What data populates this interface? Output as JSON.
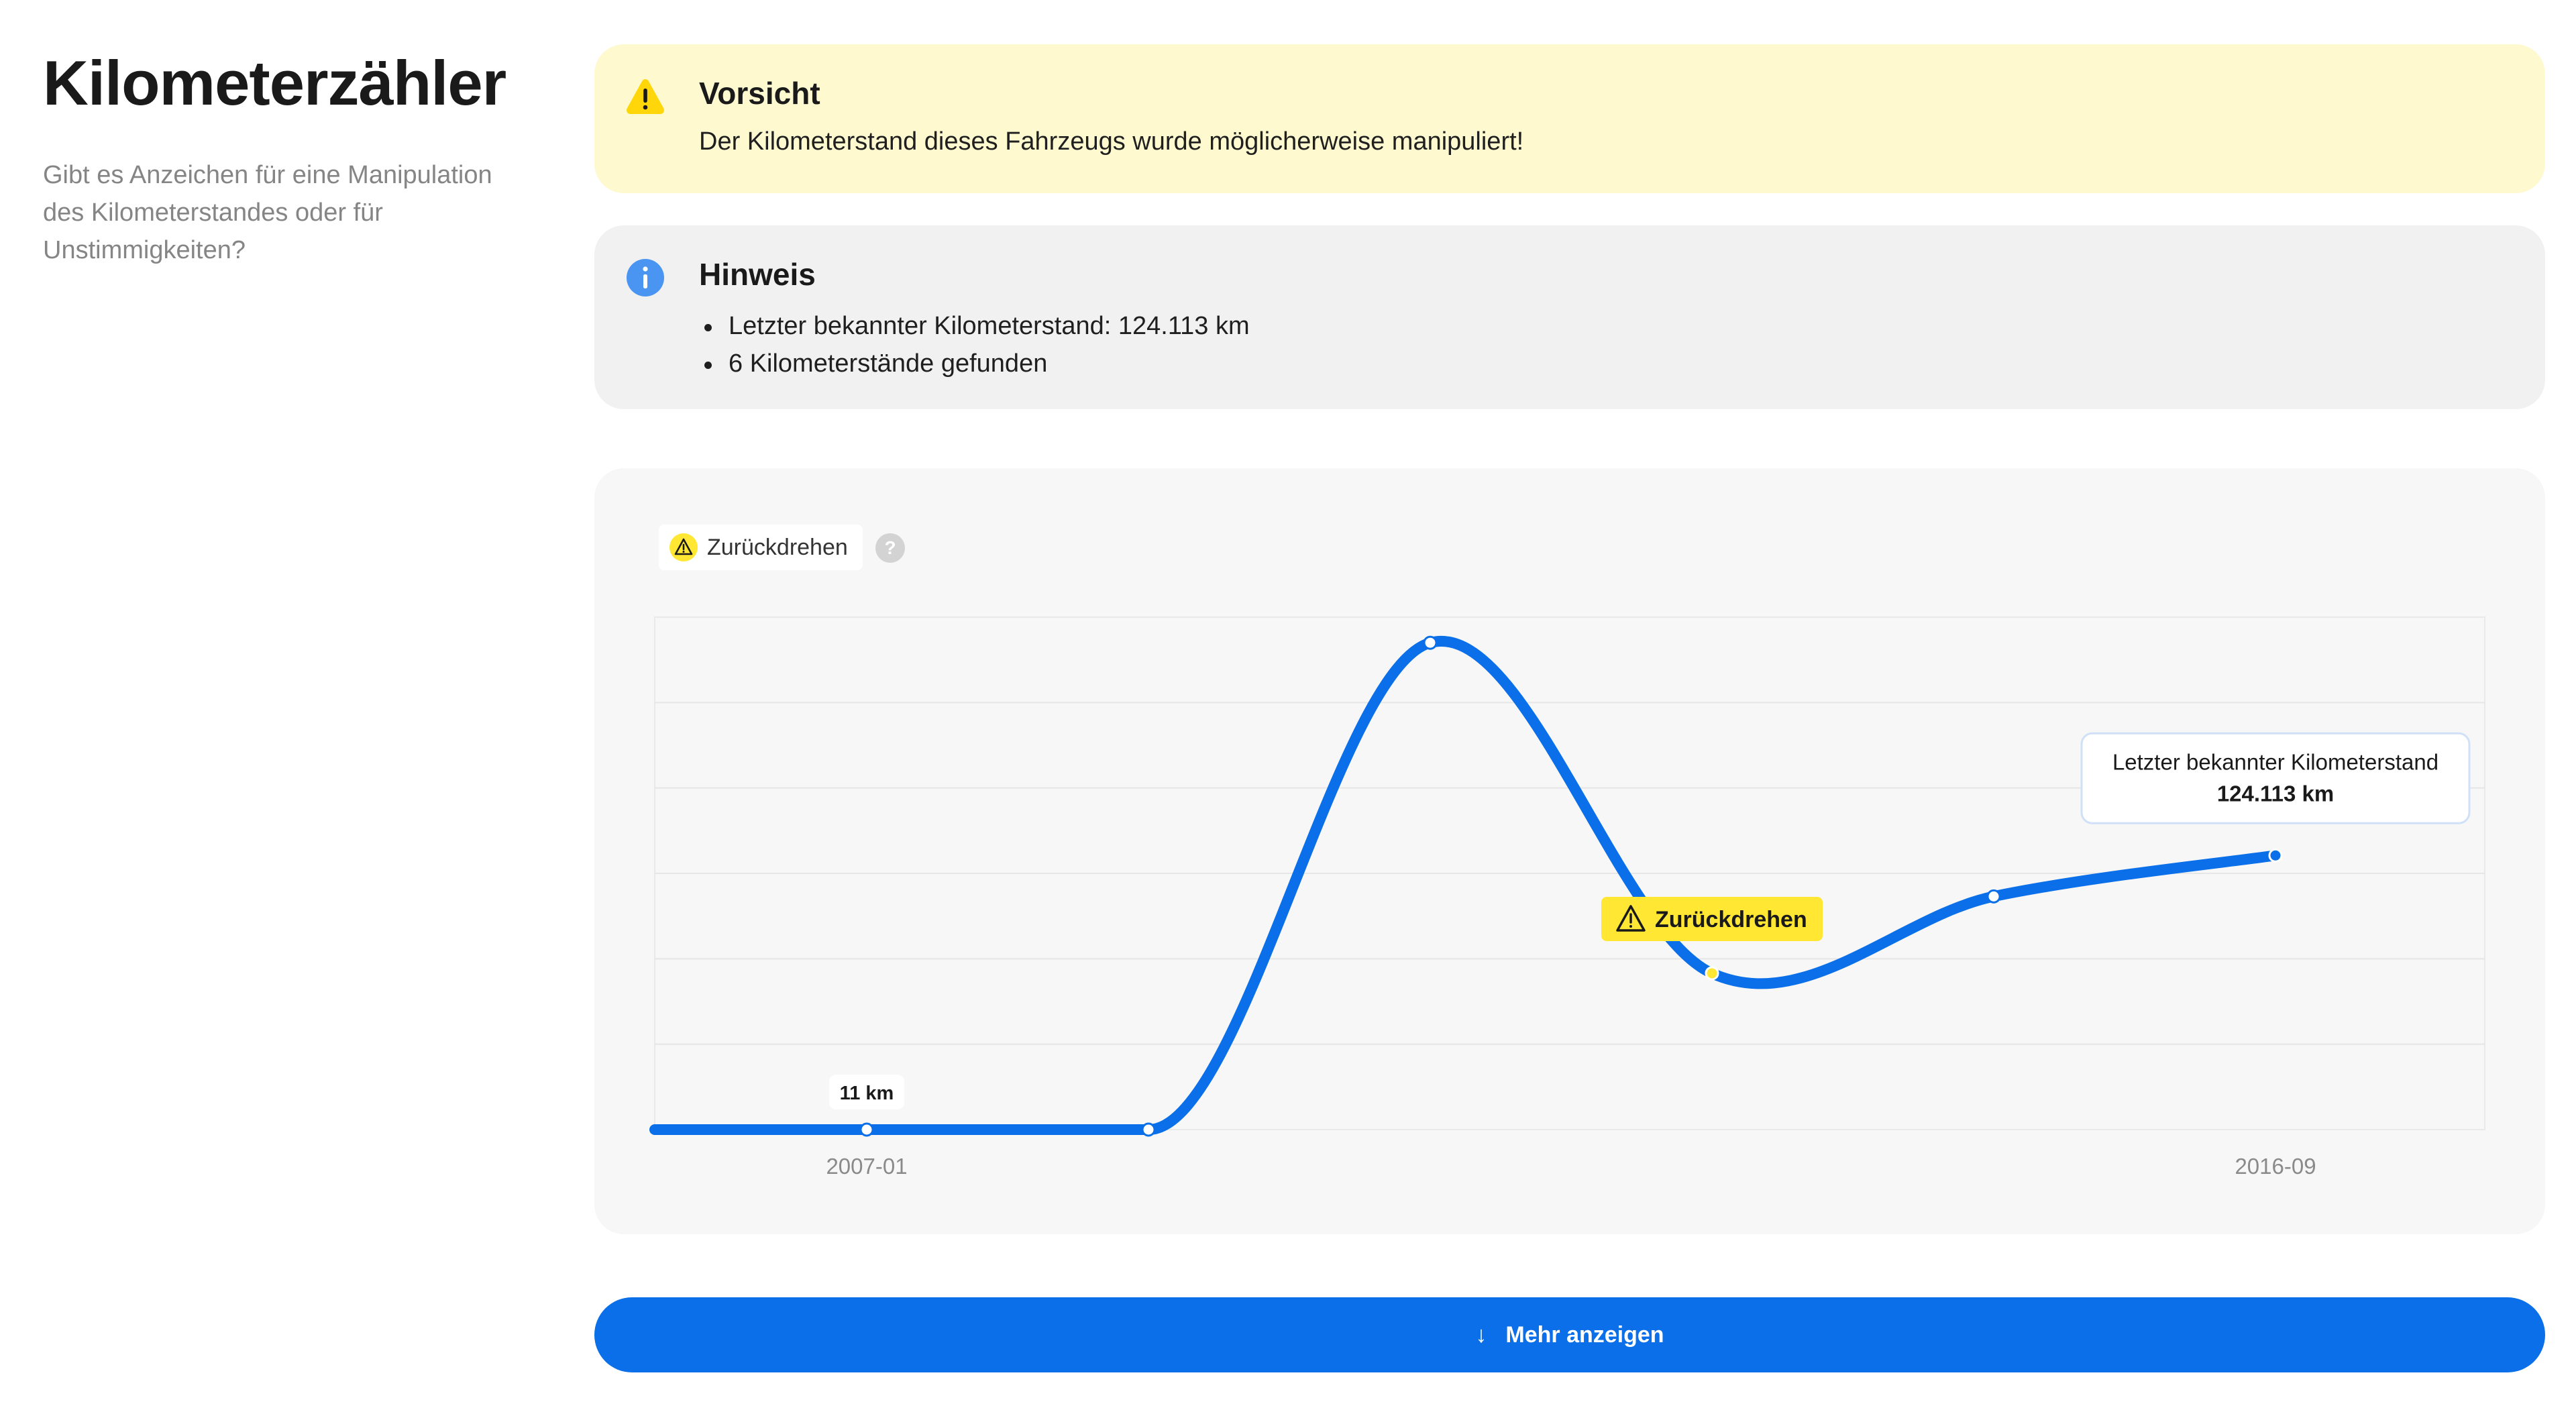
{
  "left": {
    "title": "Kilometerzähler",
    "subtitle": "Gibt es Anzeichen für eine Manipulation des Kilometerstandes oder für Unstimmigkeiten?"
  },
  "warning": {
    "icon": "warning-triangle-icon",
    "title": "Vorsicht",
    "text": "Der Kilometerstand dieses Fahrzeugs wurde möglicherweise manipuliert!",
    "color": "#fef9cf"
  },
  "info": {
    "icon": "info-circle-icon",
    "title": "Hinweis",
    "items": [
      "Letzter bekannter Kilometerstand: 124.113 km",
      "6 Kilometerstände gefunden"
    ],
    "color": "#f1f1f1"
  },
  "legend": {
    "label": "Zurückdrehen",
    "icon": "warning-triangle-icon",
    "help_icon": "question-circle-icon"
  },
  "chart_data": {
    "type": "line",
    "x_labels": [
      "2007-01",
      "2016-09"
    ],
    "points": [
      {
        "index": 0,
        "x_label": "2007-01",
        "label": "11 km"
      },
      {
        "index": 1
      },
      {
        "index": 2
      },
      {
        "index": 3,
        "flag": "Zurückdrehen"
      },
      {
        "index": 4
      },
      {
        "index": 5,
        "x_label": "2016-09",
        "tooltip_title": "Letzter bekannter Kilometerstand",
        "tooltip_value": "124.113 km"
      }
    ],
    "relative_values": [
      0.0,
      0.0,
      0.95,
      0.305,
      0.455,
      0.535
    ],
    "grid": true,
    "series_color": "#0a6fe8",
    "flag_color": "#ffe734"
  },
  "button": {
    "label": "Mehr anzeigen",
    "icon": "arrow-down-icon",
    "color": "#0a6fe8"
  }
}
